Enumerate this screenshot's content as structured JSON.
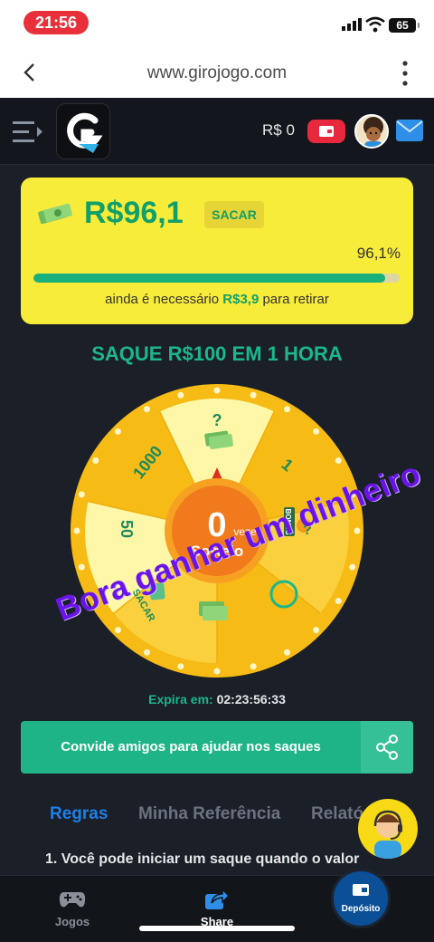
{
  "status": {
    "time": "21:56",
    "battery": "65"
  },
  "browser": {
    "url": "www.girojogo.com"
  },
  "header": {
    "balance": "R$ 0"
  },
  "card": {
    "amount": "R$96,1",
    "withdraw_label": "SACAR",
    "percent_text": "96,1%",
    "progress": 0.961,
    "need_prefix": "ainda é necessário",
    "need_amount": "R$3,9",
    "need_suffix": "para retirar"
  },
  "headline": "SAQUE R$100 EM 1 HORA",
  "wheel": {
    "segments": [
      "?",
      "1",
      "?",
      "",
      "SACAR",
      "50",
      "1000"
    ],
    "bonus_label": "BONUS",
    "spins_count": "0",
    "spins_unit": "vezes",
    "spin_button_label": "Sorteio"
  },
  "overlay_text": "Bora ganhar um dinheiro",
  "expira": {
    "label": "Expira em:",
    "time": "02:23:56:33"
  },
  "invite_label": "Convide amigos para ajudar nos saques",
  "tabs": [
    "Regras",
    "Minha Referência",
    "Relató"
  ],
  "rule_text": "1. Você pode iniciar um saque quando o valor",
  "nav": {
    "games": "Jogos",
    "share": "Share",
    "deposit": "Depósito"
  },
  "colors": {
    "accent_green": "#1bb78b",
    "card_yellow": "#f8ec3a",
    "active_tab": "#1e7fe6",
    "overlay_purple": "#6a14ea"
  }
}
